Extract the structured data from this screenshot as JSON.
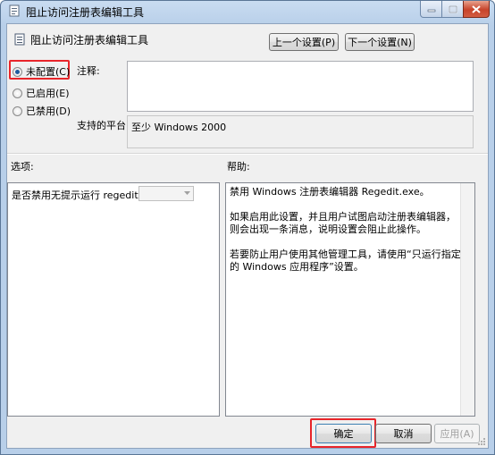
{
  "window": {
    "title": "阻止访问注册表编辑工具",
    "minimize_icon": "minimize-icon",
    "maximize_icon": "maximize-icon",
    "close_icon": "close-icon"
  },
  "header": {
    "policy_title": "阻止访问注册表编辑工具",
    "prev_setting": "上一个设置(P)",
    "next_setting": "下一个设置(N)"
  },
  "state": {
    "options": [
      {
        "label": "未配置(C)",
        "selected": true
      },
      {
        "label": "已启用(E)",
        "selected": false
      },
      {
        "label": "已禁用(D)",
        "selected": false
      }
    ]
  },
  "comment": {
    "label": "注释:",
    "value": ""
  },
  "platform": {
    "label": "支持的平台:",
    "value": "至少 Windows 2000"
  },
  "options_section": {
    "label": "选项:",
    "question": "是否禁用无提示运行 regedit ?",
    "select_value": ""
  },
  "help_section": {
    "label": "帮助:",
    "paragraphs": [
      "禁用 Windows 注册表编辑器 Regedit.exe。",
      "如果启用此设置，并且用户试图启动注册表编辑器，则会出现一条消息，说明设置会阻止此操作。",
      "若要防止用户使用其他管理工具，请使用“只运行指定的 Windows 应用程序”设置。"
    ]
  },
  "footer": {
    "ok": "确定",
    "cancel": "取消",
    "apply": "应用(A)"
  },
  "colors": {
    "highlight": "#e8252a",
    "radio_dot": "#1f5b9e",
    "titlebar": "#c9dcf1",
    "close_button": "#c7432a"
  }
}
